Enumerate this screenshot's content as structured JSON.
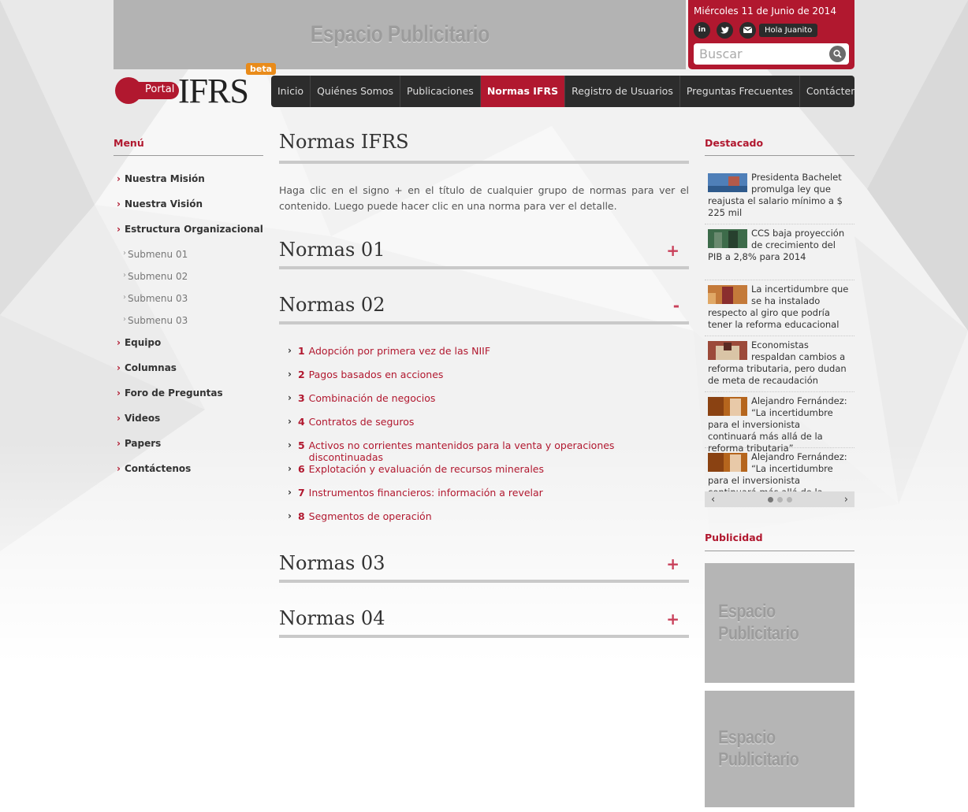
{
  "top_ad": {
    "text": "Espacio Publicitario"
  },
  "header": {
    "date": "Miércoles 11 de Junio de 2014",
    "social": [
      "in",
      "t",
      "mail"
    ],
    "greeting": "Hola Juanito",
    "search_placeholder": "Buscar"
  },
  "logo": {
    "portal": "Portal",
    "brand": "IFRS",
    "badge": "beta"
  },
  "nav": {
    "items": [
      {
        "label": "Inicio"
      },
      {
        "label": "Quiénes Somos"
      },
      {
        "label": "Publicaciones"
      },
      {
        "label": "Normas IFRS",
        "active": true
      },
      {
        "label": "Registro de Usuarios"
      },
      {
        "label": "Preguntas Frecuentes"
      },
      {
        "label": "Contáctenos"
      }
    ]
  },
  "sidebar": {
    "title": "Menú",
    "items": [
      {
        "label": "Nuestra Misión"
      },
      {
        "label": "Nuestra Visión"
      },
      {
        "label": "Estructura Organizacional"
      },
      {
        "label": "Submenu 01",
        "sub": true
      },
      {
        "label": "Submenu 02",
        "sub": true
      },
      {
        "label": "Submenu 03",
        "sub": true
      },
      {
        "label": "Submenu 03",
        "sub": true
      },
      {
        "label": "Equipo"
      },
      {
        "label": "Columnas"
      },
      {
        "label": "Foro de Preguntas"
      },
      {
        "label": "Videos"
      },
      {
        "label": "Papers"
      },
      {
        "label": "Contáctenos"
      }
    ]
  },
  "main": {
    "title": "Normas IFRS",
    "intro": "Haga clic en el signo + en el título de cualquier grupo de normas para ver el contenido. Luego puede hacer clic en una norma para ver el detalle.",
    "groups": [
      {
        "title": "Normas 01",
        "toggle": "+"
      },
      {
        "title": "Normas 02",
        "toggle": "-"
      },
      {
        "title": "Normas 03",
        "toggle": "+"
      },
      {
        "title": "Normas 04",
        "toggle": "+"
      }
    ],
    "norms": [
      {
        "num": "1",
        "label": "Adopción por primera vez de las NIIF"
      },
      {
        "num": "2",
        "label": "Pagos basados en acciones"
      },
      {
        "num": "3",
        "label": "Combinación de negocios"
      },
      {
        "num": "4",
        "label": "Contratos de seguros"
      },
      {
        "num": "5",
        "label": "Activos no corrientes mantenidos para la venta y operaciones discontinuadas"
      },
      {
        "num": "6",
        "label": "Explotación y evaluación de recursos minerales"
      },
      {
        "num": "7",
        "label": "Instrumentos financieros: información a revelar"
      },
      {
        "num": "8",
        "label": "Segmentos de operación"
      }
    ]
  },
  "destacado": {
    "title": "Destacado",
    "news": [
      {
        "text": "Presidenta Bachelet promulga ley que reajusta el salario mínimo a $ 225 mil"
      },
      {
        "text": "CCS baja proyección de crecimiento del PIB a 2,8% para 2014"
      },
      {
        "text": "La incertidumbre que se ha instalado respecto al giro que podría tener la reforma educacional"
      },
      {
        "text": "Economistas respaldan cambios a reforma tributaria, pero dudan de meta de recaudación"
      },
      {
        "text": "Alejandro Fernández: “La incertidumbre para el inversionista continuará más allá de la reforma tributaria”"
      },
      {
        "text": "Alejandro Fernández: “La incertidumbre para el inversionista continuará más allá de la reforma tributaria”"
      }
    ]
  },
  "publicidad": {
    "title": "Publicidad",
    "ads": [
      {
        "text": "Espacio Publicitario"
      },
      {
        "text": "Espacio Publicitario"
      }
    ]
  },
  "colors": {
    "brand_red": "#b1182f",
    "nav_dark": "#2c2c2c",
    "ad_gray": "#b5b5b5"
  }
}
